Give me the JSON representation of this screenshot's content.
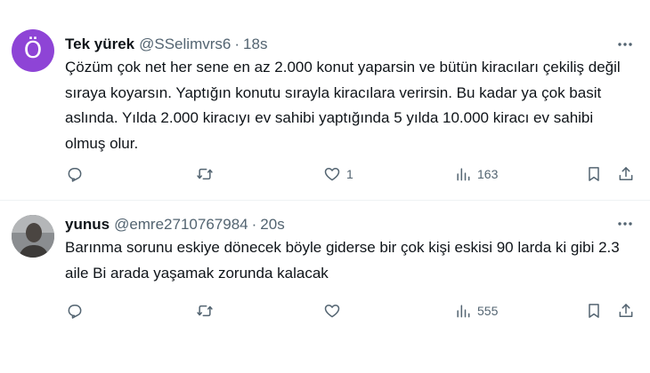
{
  "tweets": [
    {
      "avatar_letter": "Ö",
      "avatar_color": "#8e44d6",
      "name": "Tek yürek",
      "handle": "@SSelimvrs6",
      "separator": "·",
      "time": "18s",
      "text": "Çözüm çok net her sene en az 2.000 konut yaparsin ve bütün kiracıları çekiliş değil sıraya koyarsın. Yaptığın konutu sırayla kiracılara verirsin. Bu kadar ya çok basit aslında. Yılda 2.000 kiracıyı ev sahibi yaptığında 5 yılda 10.000 kiracı ev sahibi olmuş olur.",
      "likes": "1",
      "views": "163"
    },
    {
      "name": "yunus",
      "handle": "@emre2710767984",
      "separator": "·",
      "time": "20s",
      "text": "Barınma sorunu eskiye dönecek böyle giderse bir çok kişi eskisi 90 larda ki gibi 2.3 aile Bi arada yaşamak zorunda kalacak",
      "views": "555"
    }
  ],
  "icons": {
    "reply": "reply-icon",
    "retweet": "retweet-icon",
    "like": "heart-icon",
    "views": "views-icon",
    "bookmark": "bookmark-icon",
    "share": "share-icon",
    "more": "more-icon"
  }
}
